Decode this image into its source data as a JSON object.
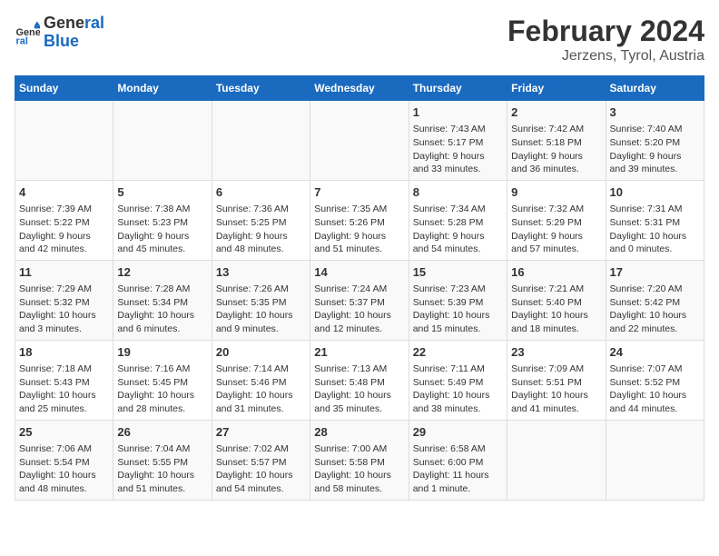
{
  "header": {
    "logo_line1": "General",
    "logo_line2": "Blue",
    "title": "February 2024",
    "subtitle": "Jerzens, Tyrol, Austria"
  },
  "weekdays": [
    "Sunday",
    "Monday",
    "Tuesday",
    "Wednesday",
    "Thursday",
    "Friday",
    "Saturday"
  ],
  "weeks": [
    [
      {
        "day": "",
        "info": ""
      },
      {
        "day": "",
        "info": ""
      },
      {
        "day": "",
        "info": ""
      },
      {
        "day": "",
        "info": ""
      },
      {
        "day": "1",
        "info": "Sunrise: 7:43 AM\nSunset: 5:17 PM\nDaylight: 9 hours\nand 33 minutes."
      },
      {
        "day": "2",
        "info": "Sunrise: 7:42 AM\nSunset: 5:18 PM\nDaylight: 9 hours\nand 36 minutes."
      },
      {
        "day": "3",
        "info": "Sunrise: 7:40 AM\nSunset: 5:20 PM\nDaylight: 9 hours\nand 39 minutes."
      }
    ],
    [
      {
        "day": "4",
        "info": "Sunrise: 7:39 AM\nSunset: 5:22 PM\nDaylight: 9 hours\nand 42 minutes."
      },
      {
        "day": "5",
        "info": "Sunrise: 7:38 AM\nSunset: 5:23 PM\nDaylight: 9 hours\nand 45 minutes."
      },
      {
        "day": "6",
        "info": "Sunrise: 7:36 AM\nSunset: 5:25 PM\nDaylight: 9 hours\nand 48 minutes."
      },
      {
        "day": "7",
        "info": "Sunrise: 7:35 AM\nSunset: 5:26 PM\nDaylight: 9 hours\nand 51 minutes."
      },
      {
        "day": "8",
        "info": "Sunrise: 7:34 AM\nSunset: 5:28 PM\nDaylight: 9 hours\nand 54 minutes."
      },
      {
        "day": "9",
        "info": "Sunrise: 7:32 AM\nSunset: 5:29 PM\nDaylight: 9 hours\nand 57 minutes."
      },
      {
        "day": "10",
        "info": "Sunrise: 7:31 AM\nSunset: 5:31 PM\nDaylight: 10 hours\nand 0 minutes."
      }
    ],
    [
      {
        "day": "11",
        "info": "Sunrise: 7:29 AM\nSunset: 5:32 PM\nDaylight: 10 hours\nand 3 minutes."
      },
      {
        "day": "12",
        "info": "Sunrise: 7:28 AM\nSunset: 5:34 PM\nDaylight: 10 hours\nand 6 minutes."
      },
      {
        "day": "13",
        "info": "Sunrise: 7:26 AM\nSunset: 5:35 PM\nDaylight: 10 hours\nand 9 minutes."
      },
      {
        "day": "14",
        "info": "Sunrise: 7:24 AM\nSunset: 5:37 PM\nDaylight: 10 hours\nand 12 minutes."
      },
      {
        "day": "15",
        "info": "Sunrise: 7:23 AM\nSunset: 5:39 PM\nDaylight: 10 hours\nand 15 minutes."
      },
      {
        "day": "16",
        "info": "Sunrise: 7:21 AM\nSunset: 5:40 PM\nDaylight: 10 hours\nand 18 minutes."
      },
      {
        "day": "17",
        "info": "Sunrise: 7:20 AM\nSunset: 5:42 PM\nDaylight: 10 hours\nand 22 minutes."
      }
    ],
    [
      {
        "day": "18",
        "info": "Sunrise: 7:18 AM\nSunset: 5:43 PM\nDaylight: 10 hours\nand 25 minutes."
      },
      {
        "day": "19",
        "info": "Sunrise: 7:16 AM\nSunset: 5:45 PM\nDaylight: 10 hours\nand 28 minutes."
      },
      {
        "day": "20",
        "info": "Sunrise: 7:14 AM\nSunset: 5:46 PM\nDaylight: 10 hours\nand 31 minutes."
      },
      {
        "day": "21",
        "info": "Sunrise: 7:13 AM\nSunset: 5:48 PM\nDaylight: 10 hours\nand 35 minutes."
      },
      {
        "day": "22",
        "info": "Sunrise: 7:11 AM\nSunset: 5:49 PM\nDaylight: 10 hours\nand 38 minutes."
      },
      {
        "day": "23",
        "info": "Sunrise: 7:09 AM\nSunset: 5:51 PM\nDaylight: 10 hours\nand 41 minutes."
      },
      {
        "day": "24",
        "info": "Sunrise: 7:07 AM\nSunset: 5:52 PM\nDaylight: 10 hours\nand 44 minutes."
      }
    ],
    [
      {
        "day": "25",
        "info": "Sunrise: 7:06 AM\nSunset: 5:54 PM\nDaylight: 10 hours\nand 48 minutes."
      },
      {
        "day": "26",
        "info": "Sunrise: 7:04 AM\nSunset: 5:55 PM\nDaylight: 10 hours\nand 51 minutes."
      },
      {
        "day": "27",
        "info": "Sunrise: 7:02 AM\nSunset: 5:57 PM\nDaylight: 10 hours\nand 54 minutes."
      },
      {
        "day": "28",
        "info": "Sunrise: 7:00 AM\nSunset: 5:58 PM\nDaylight: 10 hours\nand 58 minutes."
      },
      {
        "day": "29",
        "info": "Sunrise: 6:58 AM\nSunset: 6:00 PM\nDaylight: 11 hours\nand 1 minute."
      },
      {
        "day": "",
        "info": ""
      },
      {
        "day": "",
        "info": ""
      }
    ]
  ]
}
